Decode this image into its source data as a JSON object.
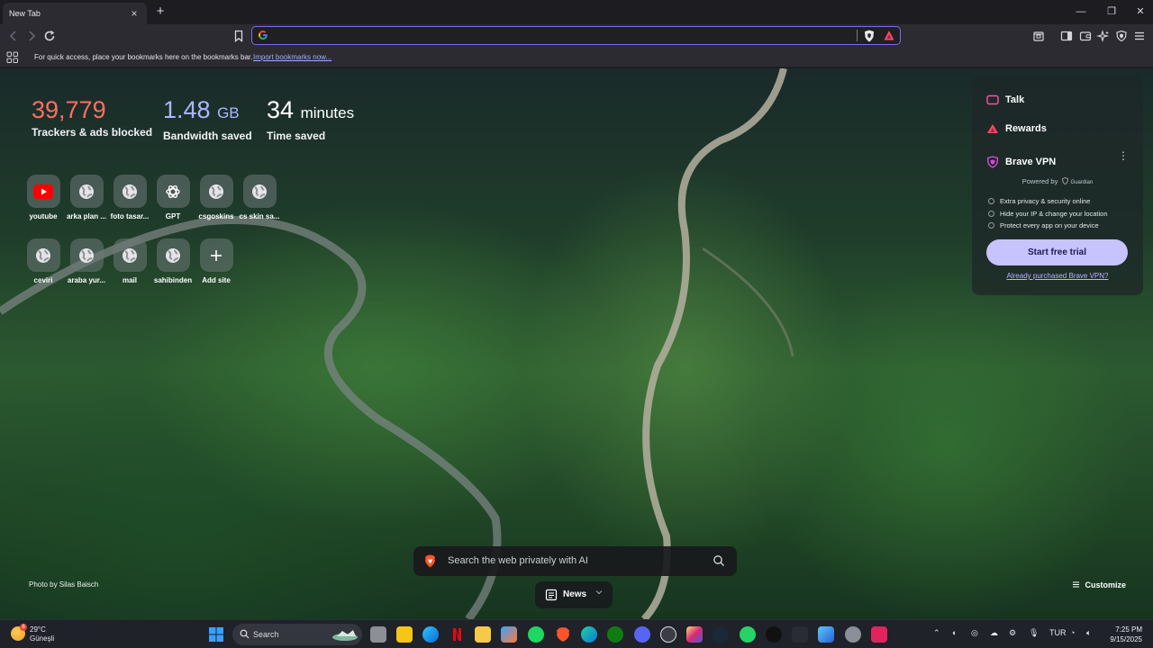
{
  "browser": {
    "tab_title": "New Tab",
    "tab_close": "×",
    "new_tab": "+",
    "window_min": "—",
    "window_max": "❐",
    "window_close": "✕",
    "address": {
      "value": "",
      "placeholder": ""
    },
    "bookmarks_bar_text": "For quick access, place your bookmarks here on the bookmarks bar.",
    "bookmarks_import_link": "Import bookmarks now..."
  },
  "stats": {
    "trackers": {
      "value": "39,779",
      "label": "Trackers & ads blocked",
      "color": "#ff6f5e"
    },
    "bandwidth": {
      "value": "1.48",
      "unit": "GB",
      "label": "Bandwidth saved",
      "color": "#a9b8ff"
    },
    "time": {
      "value": "34",
      "unit": "minutes",
      "label": "Time saved",
      "color": "#ffffff"
    }
  },
  "top_sites": [
    {
      "name": "youtube",
      "icon": "youtube-icon"
    },
    {
      "name": "arka plan ...",
      "icon": "globe-icon"
    },
    {
      "name": "foto tasar...",
      "icon": "globe-icon"
    },
    {
      "name": "GPT",
      "icon": "openai-icon"
    },
    {
      "name": "csgoskins",
      "icon": "globe-icon"
    },
    {
      "name": "cs skin sa...",
      "icon": "globe-icon"
    },
    {
      "name": "ceviri",
      "icon": "globe-icon"
    },
    {
      "name": "araba yur...",
      "icon": "globe-icon"
    },
    {
      "name": "mail",
      "icon": "globe-icon"
    },
    {
      "name": "sahibinden",
      "icon": "globe-icon"
    },
    {
      "name": "Add site",
      "icon": "plus-icon"
    }
  ],
  "panel": {
    "talk": "Talk",
    "rewards": "Rewards",
    "vpn": "Brave VPN",
    "kebab": "⋮",
    "powered_by": "Powered by",
    "guardian": "Guardian",
    "features": [
      "Extra privacy & security online",
      "Hide your IP & change your location",
      "Protect every app on your device"
    ],
    "trial_button": "Start free trial",
    "purchased_link": "Already purchased Brave VPN?"
  },
  "page": {
    "photo_credit": "Photo by Silas Baisch",
    "search_placeholder": "Search the web privately with AI",
    "news": "News",
    "customize": "Customize"
  },
  "taskbar": {
    "temperature": "29°C",
    "weather_location": "Güneşli",
    "weather_badge": "8",
    "search_placeholder": "Search",
    "language": "TUR",
    "time": "7:25 PM",
    "date": "9/15/2025"
  }
}
